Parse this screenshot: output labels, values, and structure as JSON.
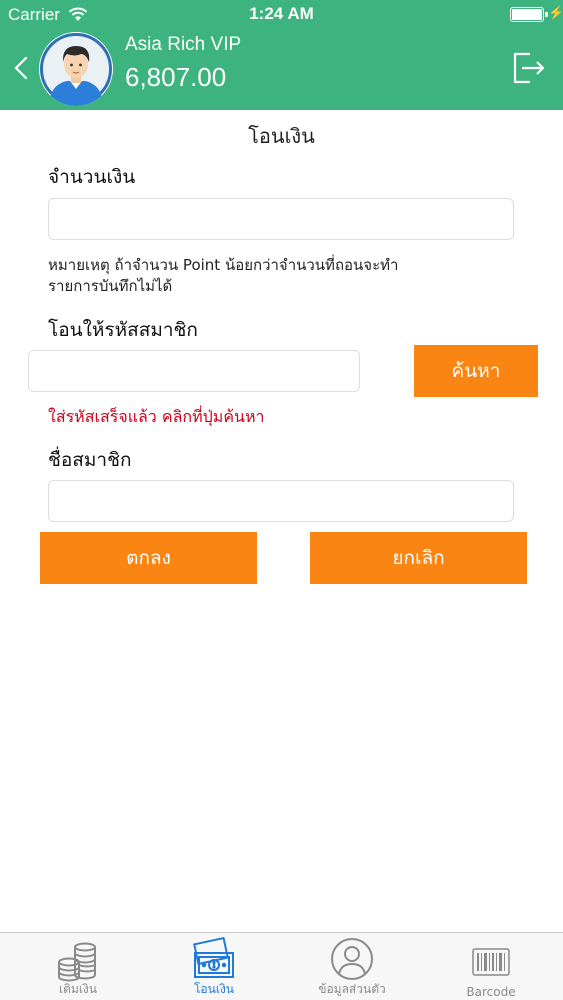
{
  "status_bar": {
    "carrier": "Carrier",
    "time": "1:24 AM"
  },
  "header": {
    "user_name": "Asia Rich VIP",
    "balance": "6,807.00"
  },
  "page": {
    "title": "โอนเงิน",
    "amount_label": "จำนวนเงิน",
    "amount_value": "",
    "note_line1": "หมายเหตุ ถ้าจำนวน Point น้อยกว่าจำนวนที่ถอนจะทำ",
    "note_line2": "รายการบันทึกไม่ได้",
    "member_code_label": "โอนให้รหัสสมาชิก",
    "member_code_value": "",
    "search_button": "ค้นหา",
    "hint": "ใส่รหัสเสร็จแล้ว คลิกที่ปุ่มค้นหา",
    "member_name_label": "ชื่อสมาชิก",
    "member_name_value": "",
    "confirm_button": "ตกลง",
    "cancel_button": "ยกเลิก"
  },
  "tabs": [
    {
      "label": "เติมเงิน",
      "icon": "coins-icon",
      "active": false
    },
    {
      "label": "โอนเงิน",
      "icon": "money-transfer-icon",
      "active": true
    },
    {
      "label": "ข้อมูลส่วนตัว",
      "icon": "profile-icon",
      "active": false
    },
    {
      "label": "Barcode",
      "icon": "barcode-icon",
      "active": false
    }
  ],
  "colors": {
    "header_bg": "#3db47f",
    "button_orange": "#fb8512",
    "hint_red": "#d0021b",
    "tab_active": "#1f7bd8",
    "tab_inactive": "#8a8a8a"
  }
}
